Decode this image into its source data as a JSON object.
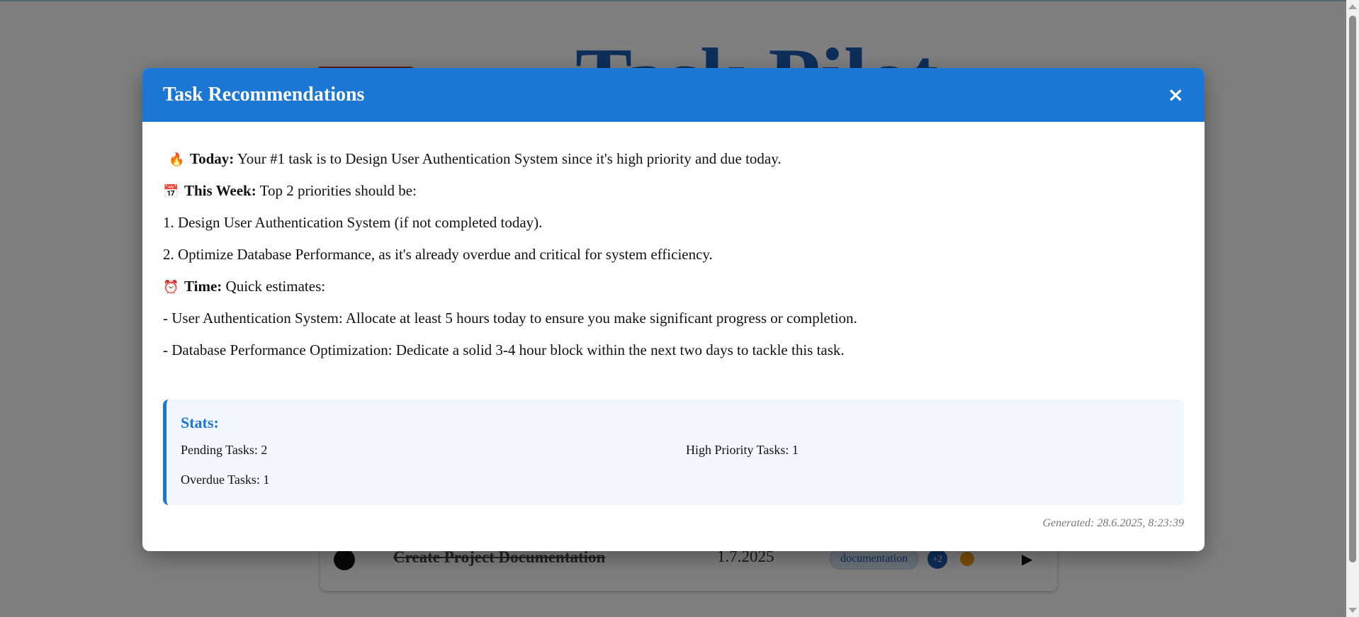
{
  "background_app": {
    "title": "Task Pilot",
    "task": {
      "name": "Create Project Documentation",
      "date": "1.7.2025",
      "tag": "documentation",
      "more_tags": "+2"
    }
  },
  "modal": {
    "title": "Task Recommendations",
    "close_label": "×",
    "recommendations": {
      "today_icon": "🔥",
      "today_label": "Today:",
      "today_text": " Your #1 task is to Design User Authentication System since it's high priority and due today.",
      "week_icon": "📅",
      "week_label": "This Week:",
      "week_text": " Top 2 priorities should be:",
      "week_item_1": "1. Design User Authentication System (if not completed today).",
      "week_item_2": "2. Optimize Database Performance, as it's already overdue and critical for system efficiency.",
      "time_icon": "⏰",
      "time_label": "Time:",
      "time_text": " Quick estimates:",
      "time_item_1": "- User Authentication System: Allocate at least 5 hours today to ensure you make significant progress or completion.",
      "time_item_2": "- Database Performance Optimization: Dedicate a solid 3-4 hour block within the next two days to tackle this task."
    },
    "stats": {
      "title": "Stats:",
      "pending": "Pending Tasks: 2",
      "high_priority": "High Priority Tasks: 1",
      "overdue": "Overdue Tasks: 1"
    },
    "generated": "Generated: 28.6.2025, 8:23:39"
  },
  "colors": {
    "header_blue": "#1a77d4",
    "stats_bg": "#f2f7fd",
    "priority_orange": "#f39c12"
  },
  "icons": {
    "today": "fire-icon",
    "week": "calendar-icon",
    "time": "alarm-clock-icon",
    "close": "close-icon",
    "play": "play-icon"
  }
}
